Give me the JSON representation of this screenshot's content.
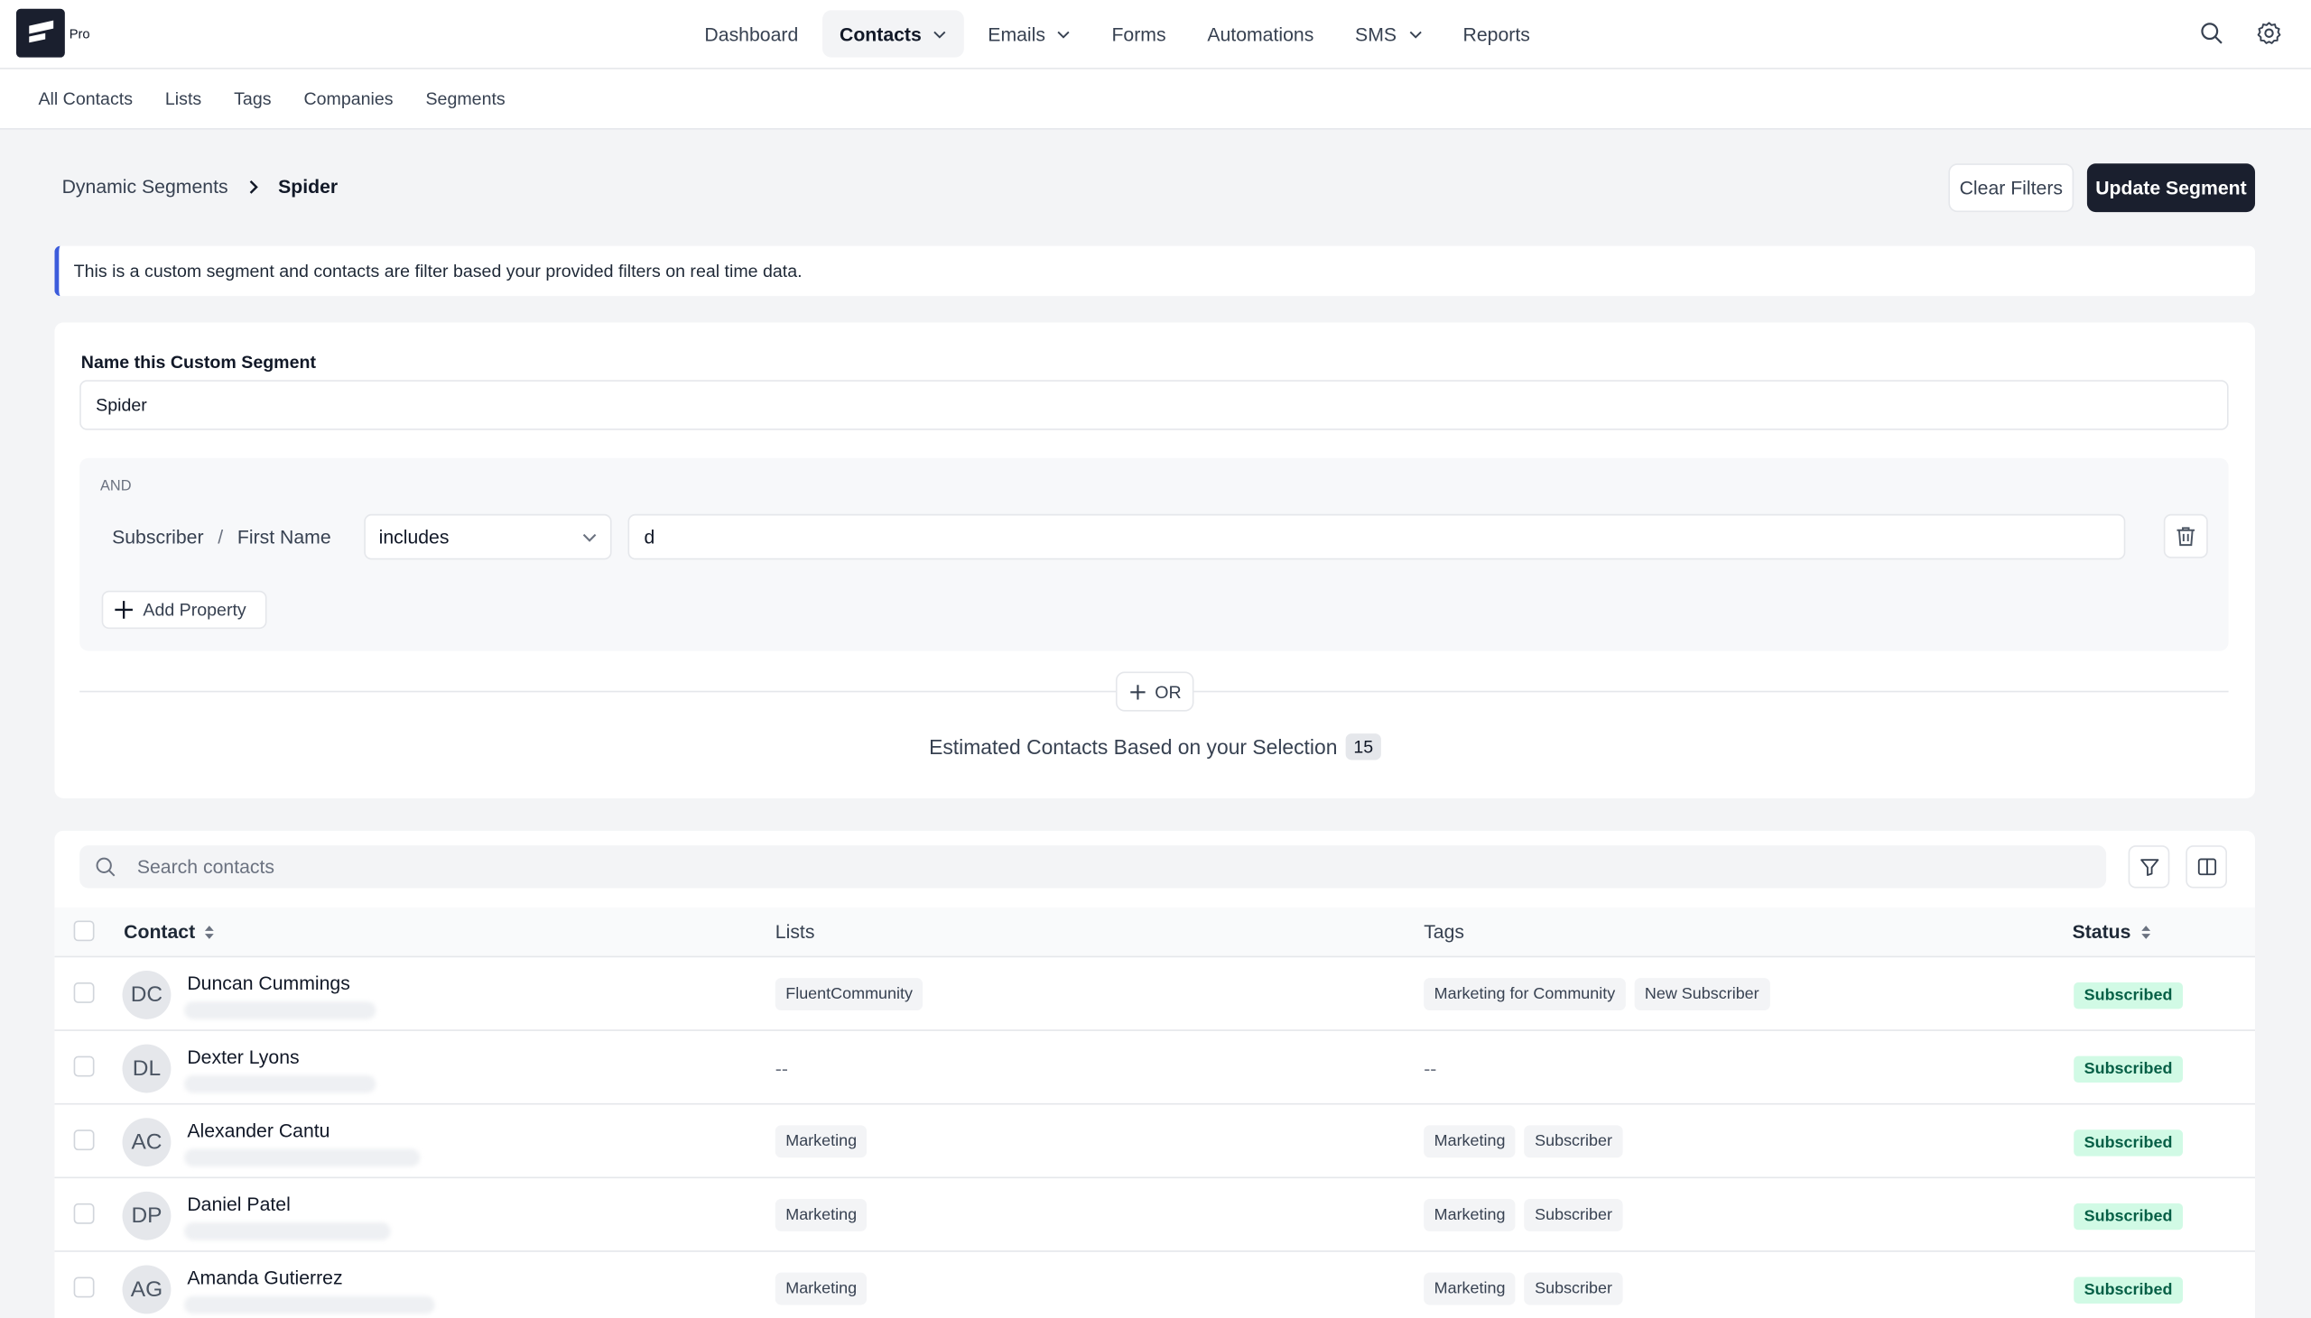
{
  "app": {
    "badge": "Pro"
  },
  "nav": {
    "items": [
      {
        "label": "Dashboard",
        "active": false,
        "dropdown": false
      },
      {
        "label": "Contacts",
        "active": true,
        "dropdown": true
      },
      {
        "label": "Emails",
        "active": false,
        "dropdown": true
      },
      {
        "label": "Forms",
        "active": false,
        "dropdown": false
      },
      {
        "label": "Automations",
        "active": false,
        "dropdown": false
      },
      {
        "label": "SMS",
        "active": false,
        "dropdown": true
      },
      {
        "label": "Reports",
        "active": false,
        "dropdown": false
      }
    ]
  },
  "subnav": [
    "All Contacts",
    "Lists",
    "Tags",
    "Companies",
    "Segments"
  ],
  "breadcrumb": {
    "parent": "Dynamic Segments",
    "current": "Spider"
  },
  "actions": {
    "clear": "Clear Filters",
    "update": "Update Segment"
  },
  "notice": "This is a custom segment and contacts are filter based your provided filters on real time data.",
  "segment": {
    "name_label": "Name this Custom Segment",
    "name_value": "Spider",
    "group_label": "AND",
    "property_group": "Subscriber",
    "property_sep": "/",
    "property_name": "First Name",
    "operator": "includes",
    "value": "d",
    "add_property": "Add Property",
    "or_label": "OR",
    "estimate_text": "Estimated Contacts Based on your Selection",
    "estimate_count": "15"
  },
  "table": {
    "search_placeholder": "Search contacts",
    "headers": {
      "contact": "Contact",
      "lists": "Lists",
      "tags": "Tags",
      "status": "Status"
    },
    "rows": [
      {
        "initials": "DC",
        "name": "Duncan Cummings",
        "lists": [
          "FluentCommunity"
        ],
        "tags": [
          "Marketing for Community",
          "New Subscriber"
        ],
        "status": "Subscribed"
      },
      {
        "initials": "DL",
        "name": "Dexter Lyons",
        "lists": [],
        "tags": [],
        "status": "Subscribed"
      },
      {
        "initials": "AC",
        "name": "Alexander Cantu",
        "lists": [
          "Marketing"
        ],
        "tags": [
          "Marketing",
          "Subscriber"
        ],
        "status": "Subscribed"
      },
      {
        "initials": "DP",
        "name": "Daniel Patel",
        "lists": [
          "Marketing"
        ],
        "tags": [
          "Marketing",
          "Subscriber"
        ],
        "status": "Subscribed"
      },
      {
        "initials": "AG",
        "name": "Amanda Gutierrez",
        "lists": [
          "Marketing"
        ],
        "tags": [
          "Marketing",
          "Subscriber"
        ],
        "status": "Subscribed"
      }
    ],
    "empty_placeholder": "--"
  }
}
